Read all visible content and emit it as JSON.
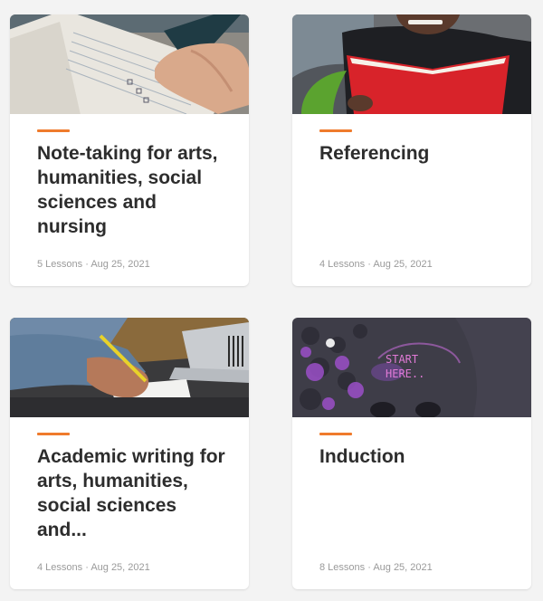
{
  "colors": {
    "accent": "#ef7b2c",
    "title": "#2d2d2d",
    "meta": "#9a9a9a",
    "page_bg": "#f3f3f3",
    "card_bg": "#ffffff"
  },
  "courses": [
    {
      "title": "Note-taking for arts, humanities, social sciences and nursing",
      "meta": "5 Lessons · Aug 25, 2021",
      "image": "hand-writing-in-notebook-photo"
    },
    {
      "title": "Referencing",
      "meta": "4 Lessons · Aug 25, 2021",
      "image": "person-reading-red-book-photo"
    },
    {
      "title": "Academic writing for arts, humanities, social sciences and...",
      "meta": "4 Lessons · Aug 25, 2021",
      "image": "writing-at-desk-with-laptop-photo"
    },
    {
      "title": "Induction",
      "meta": "8 Lessons · Aug 25, 2021",
      "image": "start-here-pavement-photo"
    }
  ]
}
